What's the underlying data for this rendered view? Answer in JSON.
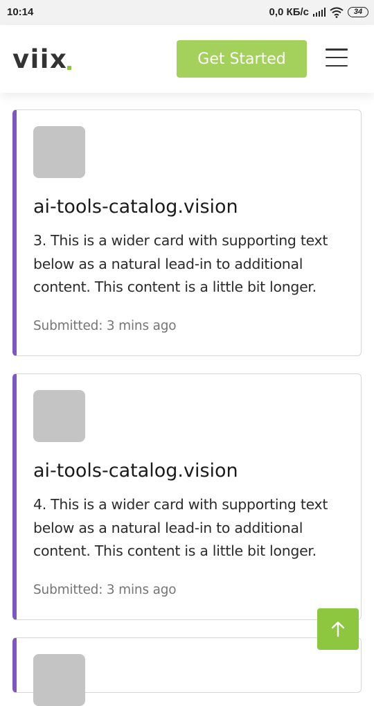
{
  "status_bar": {
    "time": "10:14",
    "network_speed": "0,0 КБ/с",
    "battery": "34"
  },
  "header": {
    "logo": "viix",
    "cta_label": "Get Started",
    "menu_icon": "hamburger-menu-icon",
    "accent_color": "#a3d15b"
  },
  "cards": [
    {
      "title": "ai-tools-catalog.vision",
      "text": "3. This is a wider card with supporting text below as a natural lead-in to additional content. This content is a little bit longer.",
      "meta": "Submitted: 3 mins ago",
      "accent_color": "#7e57c2"
    },
    {
      "title": "ai-tools-catalog.vision",
      "text": "4. This is a wider card with supporting text below as a natural lead-in to additional content. This content is a little bit longer.",
      "meta": "Submitted: 3 mins ago",
      "accent_color": "#7e57c2"
    }
  ],
  "scroll_top_icon": "arrow-up-icon"
}
